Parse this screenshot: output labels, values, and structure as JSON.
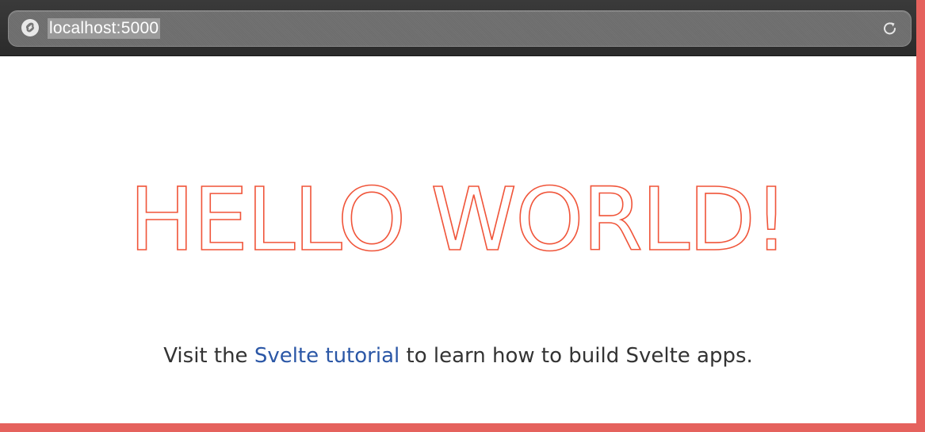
{
  "browser": {
    "address_url": "localhost:5000",
    "site_icon": "svelte-logo-icon",
    "reload_icon": "reload-icon"
  },
  "page": {
    "heading": "Hello world!",
    "visit_prefix": "Visit the ",
    "tutorial_link": "Svelte tutorial",
    "visit_suffix": " to learn how to build Svelte apps."
  },
  "colors": {
    "heading": "#ff3e00",
    "link": "#2b57a6",
    "frame": "#e5625d",
    "toolbar": "#2f2f2f"
  }
}
